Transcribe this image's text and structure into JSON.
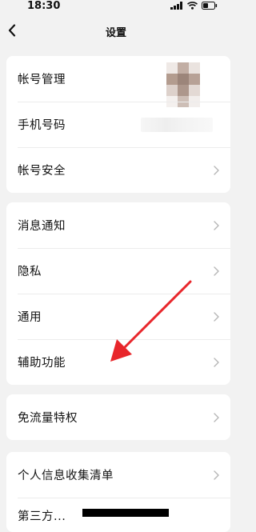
{
  "status_bar": {
    "time": "18:30"
  },
  "nav": {
    "title": "设置"
  },
  "groups": [
    {
      "items": [
        {
          "label": "帐号管理"
        },
        {
          "label": "手机号码"
        },
        {
          "label": "帐号安全"
        }
      ]
    },
    {
      "items": [
        {
          "label": "消息通知"
        },
        {
          "label": "隐私"
        },
        {
          "label": "通用"
        },
        {
          "label": "辅助功能"
        }
      ]
    },
    {
      "items": [
        {
          "label": "免流量特权"
        }
      ]
    },
    {
      "items": [
        {
          "label": "个人信息收集清单"
        },
        {
          "label": "第三方..."
        }
      ]
    }
  ],
  "annotation": {
    "arrow_color": "#e8262b",
    "points_to": "辅助功能"
  },
  "icons": {
    "back": "chevron-left-icon",
    "row": "chevron-right-icon"
  }
}
